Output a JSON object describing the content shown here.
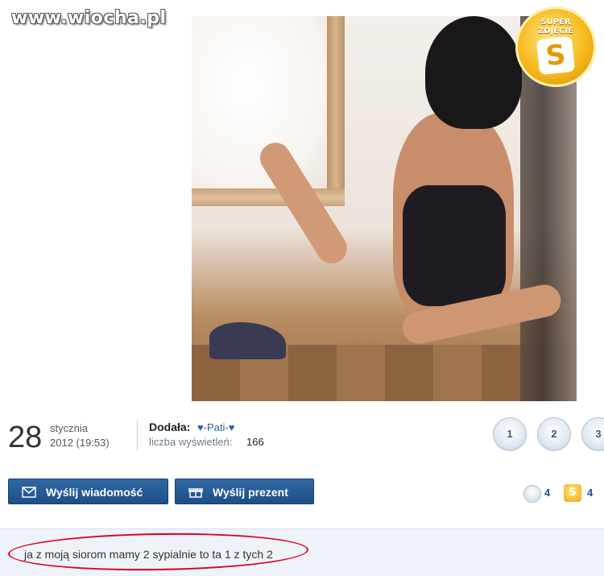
{
  "watermark": "www.wiocha.pl",
  "super_badge": {
    "line1": "SUPER",
    "line2": "ZDJĘCIE",
    "letter": "S"
  },
  "post": {
    "date_day": "28",
    "date_month": "stycznia",
    "date_year_time": "2012 (19:53)",
    "author_label": "Dodała:",
    "author_name": "♥-Pati-♥",
    "views_label": "liczba wyświetleń:",
    "views_count": "166"
  },
  "rating": {
    "stars": [
      "1",
      "2",
      "3"
    ]
  },
  "buttons": {
    "send_message": "Wyślij wiadomość",
    "send_gift": "Wyślij prezent"
  },
  "counts": {
    "stars": "4",
    "super": "4"
  },
  "comment": {
    "text": "ja z moją siorom mamy 2 sypialnie to ta 1 z tych 2"
  },
  "colors": {
    "button_blue": "#2a5f9b",
    "comment_bg": "#eef3fa",
    "highlight_red": "#e0001a",
    "badge_gold": "#f5b71a"
  }
}
